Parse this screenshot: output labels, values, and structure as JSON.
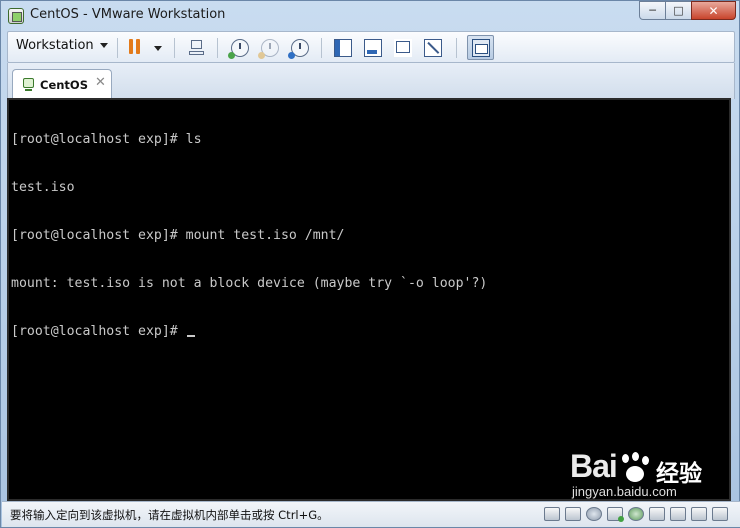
{
  "window": {
    "title": "CentOS - VMware Workstation",
    "controls": {
      "minimize": "─",
      "maximize": "□",
      "close": "✕"
    }
  },
  "toolbar": {
    "workstation_label": "Workstation",
    "icons": [
      "pause-icon",
      "network-icon",
      "snapshot-take-icon",
      "snapshot-revert-icon",
      "snapshot-manager-icon",
      "library-view-icon",
      "console-view-icon",
      "full-screen-icon",
      "unity-icon",
      "thumbnail-view-icon"
    ]
  },
  "tabs": [
    {
      "label": "CentOS",
      "close": "✕",
      "active": true
    }
  ],
  "console": {
    "lines": [
      "[root@localhost exp]# ls",
      "test.iso",
      "[root@localhost exp]# mount test.iso /mnt/",
      "mount: test.iso is not a block device (maybe try `-o loop'?)",
      "[root@localhost exp]# "
    ]
  },
  "watermark": {
    "brand": "Bai",
    "cn": "经验",
    "sub": "jingyan.baidu.com"
  },
  "status": {
    "text": "要将输入定向到该虚拟机，请在虚拟机内部单击或按 Ctrl+G。",
    "icons": [
      "hard-disk-icon",
      "hard-disk-icon",
      "cd-dvd-icon",
      "network-adapter-icon",
      "usb-icon",
      "sound-icon",
      "printer-icon",
      "display-icon",
      "message-icon"
    ]
  },
  "colors": {
    "accent_pause": "#e37a1a",
    "console_bg": "#000000",
    "console_fg": "#c9c9c9",
    "frame": "#bcd3ea"
  }
}
